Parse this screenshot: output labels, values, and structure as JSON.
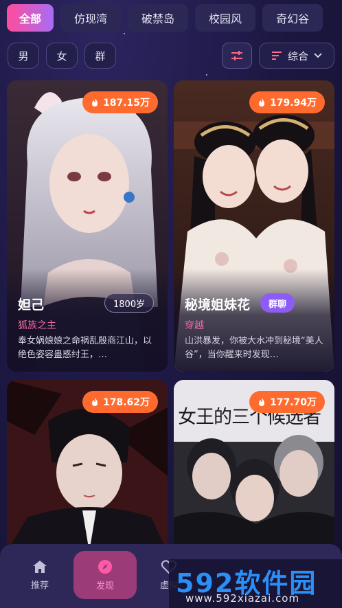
{
  "tabs": [
    "全部",
    "仿现湾",
    "破禁岛",
    "校园风",
    "奇幻谷"
  ],
  "filters": {
    "genders": [
      "男",
      "女",
      "群"
    ],
    "sort_label": "综合"
  },
  "cards": [
    {
      "heat": "187.15万",
      "name": "妲己",
      "badge": "1800岁",
      "tag": "狐族之主",
      "desc": "奉女娲娘娘之命祸乱殷商江山，以绝色姿容蛊惑纣王，…"
    },
    {
      "heat": "179.94万",
      "name": "秘境姐妹花",
      "badge": "群聊",
      "tag": "穿越",
      "desc": "山洪暴发，你被大水冲到秘境“美人谷”，当你醒来时发现…"
    },
    {
      "heat": "178.62万"
    },
    {
      "heat": "177.70万",
      "poster_title": "女王的三个候选者"
    }
  ],
  "nav": {
    "items": [
      "推荐",
      "发现",
      "虚拟"
    ]
  },
  "watermark": {
    "main": "592软件园",
    "sub": "www.592xiazai.com"
  },
  "colors": {
    "accent_pink": "#ff4d9a",
    "accent_purple": "#a86cf5",
    "heat_orange": "#ff6b2e",
    "tag_pink": "#f06aa0"
  }
}
